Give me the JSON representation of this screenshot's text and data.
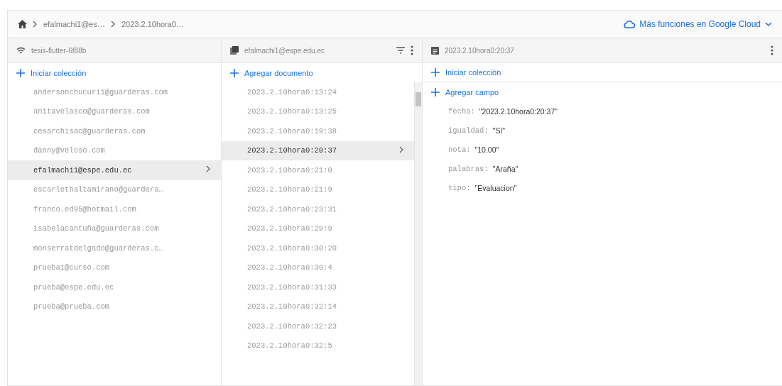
{
  "breadcrumb": [
    "efalmachi1@es…",
    "2023.2.10hora0…"
  ],
  "cloud_button": {
    "label": "Más funciones en Google Cloud"
  },
  "columns": [
    {
      "kind": "root",
      "title": "tesis-flutter-6f88b",
      "action": "Iniciar colección",
      "items": [
        {
          "label": "andersonchucuri1@guarderas.com",
          "selected": false
        },
        {
          "label": "anitavelasco@guarderas.com",
          "selected": false
        },
        {
          "label": "cesarchisac@guarderas.com",
          "selected": false
        },
        {
          "label": "danny@veloso.com",
          "selected": false
        },
        {
          "label": "efalmachi1@espe.edu.ec",
          "selected": true
        },
        {
          "label": "escarlethaltamirano@guardera…",
          "selected": false
        },
        {
          "label": "franco.ed95@hotmail.com",
          "selected": false
        },
        {
          "label": "isabelacantuña@guarderas.com",
          "selected": false
        },
        {
          "label": "monserratdelgado@guarderas.c…",
          "selected": false
        },
        {
          "label": "prueba1@curso.com",
          "selected": false
        },
        {
          "label": "prueba@espe.edu.ec",
          "selected": false
        },
        {
          "label": "prueba@prueba.com",
          "selected": false
        }
      ]
    },
    {
      "kind": "collection",
      "title": "efalmachi1@espe.edu.ec",
      "action": "Agregar documento",
      "items": [
        {
          "label": "2023.2.10hora0:13:24",
          "selected": false
        },
        {
          "label": "2023.2.10hora0:13:25",
          "selected": false
        },
        {
          "label": "2023.2.10hora0:19:38",
          "selected": false
        },
        {
          "label": "2023.2.10hora0:20:37",
          "selected": true
        },
        {
          "label": "2023.2.10hora0:21:0",
          "selected": false
        },
        {
          "label": "2023.2.10hora0:21:9",
          "selected": false
        },
        {
          "label": "2023.2.10hora0:23:31",
          "selected": false
        },
        {
          "label": "2023.2.10hora0:29:9",
          "selected": false
        },
        {
          "label": "2023.2.10hora0:30:20",
          "selected": false
        },
        {
          "label": "2023.2.10hora0:30:4",
          "selected": false
        },
        {
          "label": "2023.2.10hora0:31:33",
          "selected": false
        },
        {
          "label": "2023.2.10hora0:32:14",
          "selected": false
        },
        {
          "label": "2023.2.10hora0:32:23",
          "selected": false
        },
        {
          "label": "2023.2.10hora0:32:5",
          "selected": false
        }
      ]
    },
    {
      "kind": "document",
      "title": "2023.2.10hora0:20:37",
      "action": "Iniciar colección",
      "field_action": "Agregar campo",
      "fields": [
        {
          "name": "fecha:",
          "value": "\"2023.2.10hora0:20:37\""
        },
        {
          "name": "igualdad:",
          "value": "\"Sí\""
        },
        {
          "name": "nota:",
          "value": "\"10.00\""
        },
        {
          "name": "palabras:",
          "value": "\"Araña\""
        },
        {
          "name": "tipo:",
          "value": "\"Evaluacion\""
        }
      ]
    }
  ]
}
